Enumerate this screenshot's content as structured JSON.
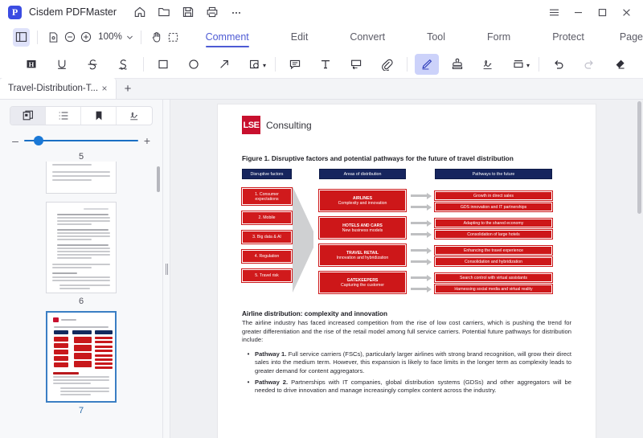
{
  "titlebar": {
    "app_name": "Cisdem PDFMaster",
    "logo_letter": "P",
    "icons": [
      {
        "name": "home-icon",
        "label": "Home"
      },
      {
        "name": "open-folder-icon",
        "label": "Open"
      },
      {
        "name": "save-icon",
        "label": "Save"
      },
      {
        "name": "print-icon",
        "label": "Print"
      },
      {
        "name": "more-icon",
        "label": "More"
      }
    ],
    "window_controls": [
      {
        "name": "menu-hamburger-icon",
        "label": "Menu"
      },
      {
        "name": "minimize-icon",
        "label": "Minimize"
      },
      {
        "name": "maximize-icon",
        "label": "Maximize"
      },
      {
        "name": "close-icon",
        "label": "Close"
      }
    ]
  },
  "ribbon": {
    "panel_toggle_label": "Toggle sidebar",
    "page_fit_label": "Page display",
    "zoom_out_label": "Zoom out",
    "zoom_in_label": "Zoom in",
    "zoom_value": "100%",
    "hand_tool_label": "Hand tool",
    "select_tool_label": "Area select",
    "tabs": [
      {
        "label": "Comment",
        "active": true
      },
      {
        "label": "Edit",
        "active": false
      },
      {
        "label": "Convert",
        "active": false
      },
      {
        "label": "Tool",
        "active": false
      },
      {
        "label": "Form",
        "active": false
      },
      {
        "label": "Protect",
        "active": false
      },
      {
        "label": "Page",
        "active": false
      }
    ]
  },
  "annotation_tools": [
    {
      "name": "highlight-icon",
      "label": "Highlight",
      "selected": false,
      "disabled": false
    },
    {
      "name": "underline-icon",
      "label": "Underline",
      "selected": false,
      "disabled": false
    },
    {
      "name": "strikethrough-icon",
      "label": "Strikethrough",
      "selected": false,
      "disabled": false
    },
    {
      "name": "squiggly-underline-icon",
      "label": "Squiggly",
      "selected": false,
      "disabled": false
    },
    {
      "name": "rectangle-icon",
      "label": "Rectangle",
      "selected": false,
      "disabled": false
    },
    {
      "name": "ellipse-icon",
      "label": "Ellipse",
      "selected": false,
      "disabled": false
    },
    {
      "name": "arrow-icon",
      "label": "Arrow",
      "selected": false,
      "disabled": false
    },
    {
      "name": "shapes-more-icon",
      "label": "More shapes",
      "selected": false,
      "disabled": false
    },
    {
      "name": "sticky-note-icon",
      "label": "Note",
      "selected": false,
      "disabled": false
    },
    {
      "name": "text-box-icon",
      "label": "Text",
      "selected": false,
      "disabled": false
    },
    {
      "name": "text-callout-icon",
      "label": "Text callout",
      "selected": false,
      "disabled": false
    },
    {
      "name": "attachment-icon",
      "label": "Attachment",
      "selected": false,
      "disabled": false
    },
    {
      "name": "pencil-icon",
      "label": "Pencil",
      "selected": true,
      "disabled": false
    },
    {
      "name": "stamp-icon",
      "label": "Stamp",
      "selected": false,
      "disabled": false
    },
    {
      "name": "signature-icon",
      "label": "Signature",
      "selected": false,
      "disabled": false
    },
    {
      "name": "link-area-icon",
      "label": "Link",
      "selected": false,
      "disabled": false
    },
    {
      "name": "undo-icon",
      "label": "Undo",
      "selected": false,
      "disabled": false
    },
    {
      "name": "redo-icon",
      "label": "Redo",
      "selected": false,
      "disabled": true
    },
    {
      "name": "eraser-icon",
      "label": "Eraser",
      "selected": false,
      "disabled": false
    }
  ],
  "tabstrip": {
    "document_tab_label": "Travel-Distribution-T...",
    "close_label": "×",
    "new_tab_label": "+"
  },
  "sidebar": {
    "segments": [
      {
        "name": "thumbnails-view",
        "label": "Thumbnails",
        "active": true
      },
      {
        "name": "outline-view",
        "label": "Outline",
        "active": false
      },
      {
        "name": "bookmarks-view",
        "label": "Bookmarks",
        "active": false
      },
      {
        "name": "signatures-view",
        "label": "Signatures",
        "active": false
      }
    ],
    "slider": {
      "minus_label": "–",
      "plus_label": "+",
      "value_label": "5"
    },
    "thumbnails": [
      {
        "page": "5",
        "current": false,
        "kind": "text"
      },
      {
        "page": "6",
        "current": false,
        "kind": "text"
      },
      {
        "page": "7",
        "current": true,
        "kind": "figure"
      }
    ]
  },
  "document": {
    "brand_mark": "LSE",
    "brand_name": "Consulting",
    "figure_title": "Figure 1. Disruptive factors and potential pathways for the future of travel distribution",
    "diagram": {
      "column_headers": [
        "Disruptive factors",
        "Areas of distribution",
        "Pathways to the future"
      ],
      "disruptive_factors": [
        "1. Consumer expectations",
        "2. Mobile",
        "3. Big data & AI",
        "4. Regulation",
        "5. Travel risk"
      ],
      "areas": [
        {
          "title": "AIRLINES",
          "subtitle": "Complexity and innovation"
        },
        {
          "title": "HOTELS AND CARS",
          "subtitle": "New business models"
        },
        {
          "title": "TRAVEL RETAIL",
          "subtitle": "Innovation and hybridization"
        },
        {
          "title": "GATEKEEPERS",
          "subtitle": "Capturing the customer"
        }
      ],
      "pathways": [
        "Growth in direct sales",
        "GDS innovation and IT partnerships",
        "Adapting to the shared economy",
        "Consolidation of large hotels",
        "Enhancing the travel experience",
        "Consolidation and hybridization",
        "Search control with virtual assistants",
        "Harnessing social media and virtual reality"
      ],
      "colors": {
        "header_navy": "#16255e",
        "box_red": "#cd1719",
        "arrow_grey": "#bfc0c2",
        "brand_red": "#c8102e"
      }
    },
    "section_heading": "Airline distribution: complexity and innovation",
    "paragraph": "The airline industry has faced increased competition from the rise of low cost carriers, which is pushing the trend for greater differentiation and the rise of the retail model among full service carriers. Potential future pathways for distribution include:",
    "bullets": [
      {
        "lead": "Pathway 1.",
        "text": " Full service carriers (FSCs), particularly larger airlines with strong brand recognition, will grow their direct sales into the medium term. However, this expansion is likely to face limits in the longer term as complexity leads to greater demand for content aggregators."
      },
      {
        "lead": "Pathway 2.",
        "text": " Partnerships with IT companies, global distribution systems (GDSs) and other aggregators will be needed to drive innovation and manage increasingly complex content across the industry."
      }
    ]
  }
}
